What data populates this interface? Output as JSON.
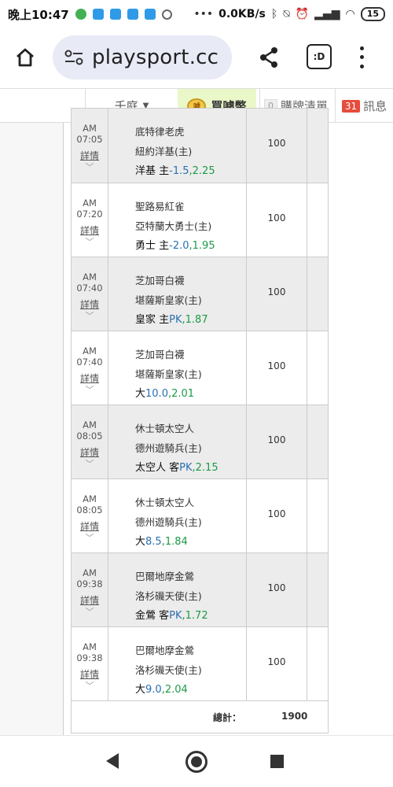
{
  "status_bar": {
    "time": "晚上10:47",
    "net_speed": "0.0KB/s",
    "battery": "15"
  },
  "browser": {
    "url": "playsport.cc",
    "tab_label": ":D"
  },
  "site_nav": {
    "league": "千庭",
    "buy_coin_label": "買噱幣",
    "coin_glyph": "噱",
    "cart_count": "0",
    "cart_label": "購牌清單",
    "msg_count": "31",
    "msg_label": "訊息"
  },
  "rows": [
    {
      "ampm": "AM",
      "time": "07:05",
      "detail": "詳情",
      "away": "底特律老虎",
      "home": "紐約洋基(主)",
      "pick_team": "洋基 主",
      "line": "-1.5",
      "odds": "2.25",
      "amount": "100",
      "shade": true
    },
    {
      "ampm": "AM",
      "time": "07:20",
      "detail": "詳情",
      "away": "聖路易紅雀",
      "home": "亞特蘭大勇士(主)",
      "pick_team": "勇士 主",
      "line": "-2.0",
      "odds": "1.95",
      "amount": "100",
      "shade": false
    },
    {
      "ampm": "AM",
      "time": "07:40",
      "detail": "詳情",
      "away": "芝加哥白襪",
      "home": "堪薩斯皇家(主)",
      "pick_team": "皇家 主",
      "line": "PK",
      "odds": "1.87",
      "amount": "100",
      "shade": true
    },
    {
      "ampm": "AM",
      "time": "07:40",
      "detail": "詳情",
      "away": "芝加哥白襪",
      "home": "堪薩斯皇家(主)",
      "pick_team": "大",
      "line": "10.0",
      "odds": "2.01",
      "amount": "100",
      "shade": false
    },
    {
      "ampm": "AM",
      "time": "08:05",
      "detail": "詳情",
      "away": "休士頓太空人",
      "home": "德州遊騎兵(主)",
      "pick_team": "太空人 客",
      "line": "PK",
      "odds": "2.15",
      "amount": "100",
      "shade": true
    },
    {
      "ampm": "AM",
      "time": "08:05",
      "detail": "詳情",
      "away": "休士頓太空人",
      "home": "德州遊騎兵(主)",
      "pick_team": "大",
      "line": "8.5",
      "odds": "1.84",
      "amount": "100",
      "shade": false
    },
    {
      "ampm": "AM",
      "time": "09:38",
      "detail": "詳情",
      "away": "巴爾地摩金鶯",
      "home": "洛杉磯天使(主)",
      "pick_team": "金鶯 客",
      "line": "PK",
      "odds": "1.72",
      "amount": "100",
      "shade": true
    },
    {
      "ampm": "AM",
      "time": "09:38",
      "detail": "詳情",
      "away": "巴爾地摩金鶯",
      "home": "洛杉磯天使(主)",
      "pick_team": "大",
      "line": "9.0",
      "odds": "2.04",
      "amount": "100",
      "shade": false
    }
  ],
  "total": {
    "label": "總計：",
    "value": "1900"
  }
}
